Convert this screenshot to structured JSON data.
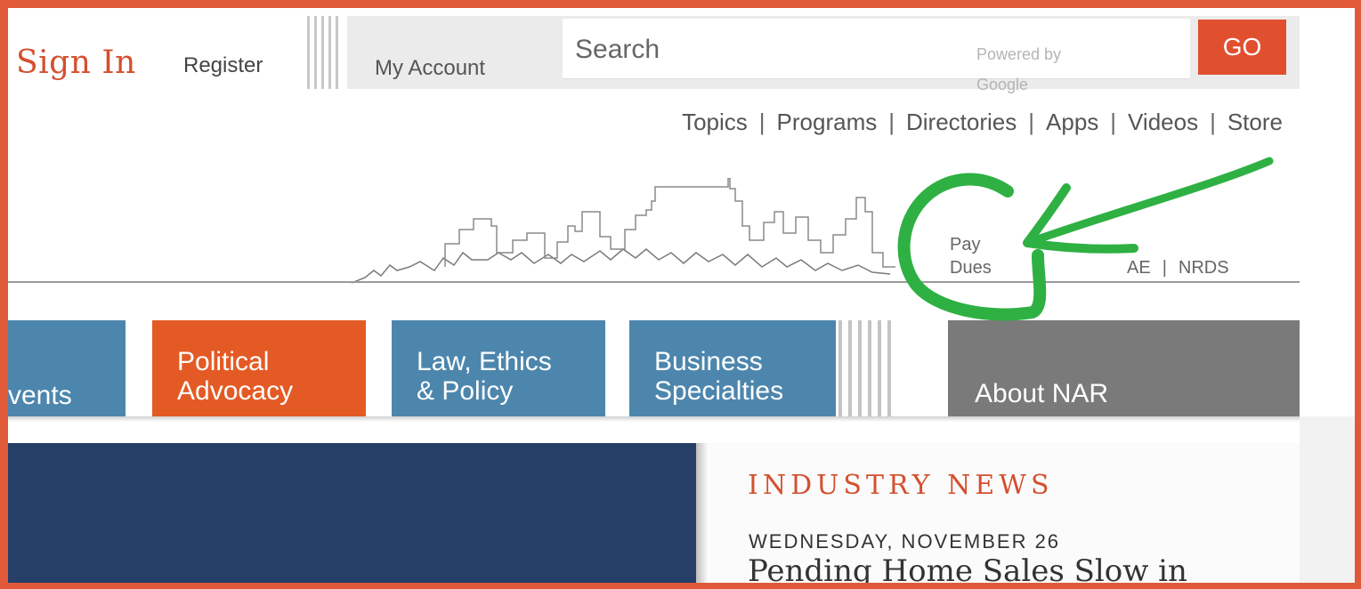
{
  "header": {
    "sign_in": "Sign In",
    "register": "Register",
    "my_account": "My Account",
    "search_placeholder": "Search",
    "powered_by": "Powered by Google",
    "go": "GO"
  },
  "top_links": [
    "Topics",
    "Programs",
    "Directories",
    "Apps",
    "Videos",
    "Store"
  ],
  "utility": {
    "pay_dues_line1": "Pay",
    "pay_dues_line2": "Dues",
    "ae": "AE",
    "nrds": "NRDS"
  },
  "nav": {
    "events": "vents",
    "political_line1": "Political",
    "political_line2": "Advocacy",
    "law_line1": "Law, Ethics",
    "law_line2": "& Policy",
    "business_line1": "Business",
    "business_line2": "Specialties",
    "about": "About NAR"
  },
  "news": {
    "heading": "INDUSTRY NEWS",
    "date": "WEDNESDAY, NOVEMBER 26",
    "headline": "Pending Home Sales Slow in"
  },
  "colors": {
    "accent": "#e0502f",
    "nav_blue": "#4d86ad",
    "nav_orange": "#e45a24",
    "nav_gray": "#7a7a7a",
    "hero_navy": "#253f66",
    "annotation_green": "#2fb043"
  }
}
